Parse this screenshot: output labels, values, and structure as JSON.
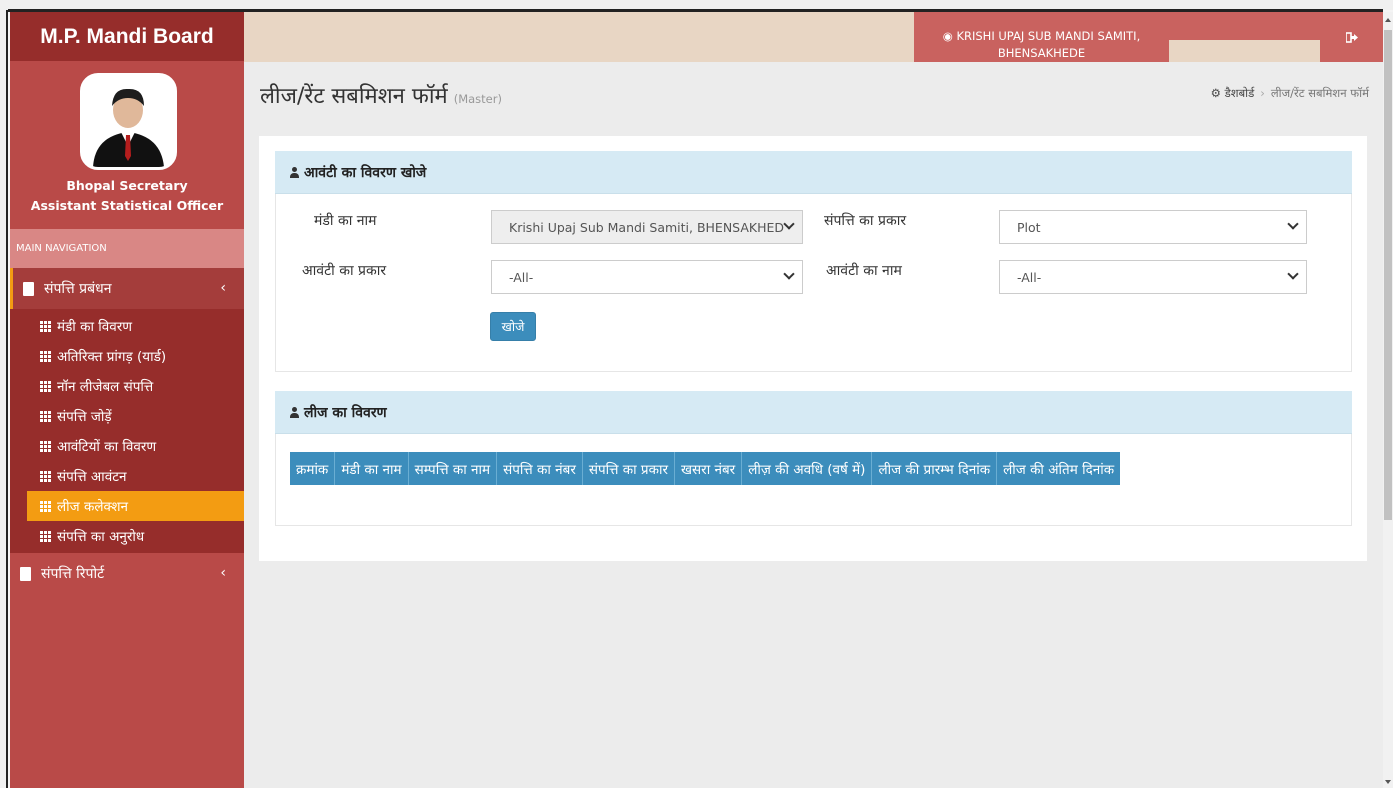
{
  "app": {
    "brand": "M.P. Mandi Board"
  },
  "user": {
    "name": "Bhopal Secretary",
    "role": "Assistant Statistical Officer"
  },
  "nav": {
    "header": "MAIN NAVIGATION",
    "group1": {
      "label": "संपत्ति प्रबंधन",
      "chevron": "‹"
    },
    "items": [
      {
        "label": "मंडी का विवरण"
      },
      {
        "label": "अतिरिक्त प्रांगड़ (यार्ड)"
      },
      {
        "label": " नॉन लीजेबल संपत्ति"
      },
      {
        "label": "संपत्ति जोड़ें"
      },
      {
        "label": "आवंटियों का विवरण"
      },
      {
        "label": "संपत्ति आवंटन"
      },
      {
        "label": "लीज कलेक्शन"
      },
      {
        "label": "संपत्ति का अनुरोध"
      }
    ],
    "group2": {
      "label": "संपत्ति रिपोर्ट",
      "chevron": "‹"
    }
  },
  "header": {
    "org_line1": "KRISHI UPAJ SUB MANDI SAMITI,",
    "org_line2": "BHENSAKHEDE",
    "logout_icon": "sign-out-icon"
  },
  "page": {
    "title": "लीज/रेंट सबमिशन फॉर्म",
    "subtitle": "(Master)",
    "breadcrumb": {
      "home": "डैशबोर्ड",
      "current": "लीज/रेंट सबमिशन फॉर्म"
    }
  },
  "search": {
    "heading": "आवंटी का विवरण खोजे",
    "mandi_label": "मंडी का नाम",
    "mandi_value": "Krishi Upaj Sub Mandi Samiti, BHENSAKHED",
    "property_type_label": "संपत्ति का प्रकार",
    "property_type_value": "Plot",
    "allottee_type_label": "आवंटी का प्रकार",
    "allottee_type_value": "-All-",
    "allottee_name_label": "आवंटी का नाम",
    "allottee_name_value": "-All-",
    "search_button": "खोजे"
  },
  "lease": {
    "heading": "लीज का विवरण",
    "columns": [
      "क्रमांक",
      "मंडी का नाम",
      "सम्पत्ति का नाम",
      "संपत्ति का नंबर",
      "संपत्ति का प्रकार",
      "खसरा नंबर",
      "लीज़ की अवधि (वर्ष में)",
      "लीज की प्रारम्भ दिनांक",
      "लीज की अंतिम दिनांक"
    ]
  },
  "colors": {
    "sidebar": "#b94a48",
    "accent": "#f39c12",
    "primary": "#3c8dbc",
    "topbar": "#e8d6c4"
  }
}
